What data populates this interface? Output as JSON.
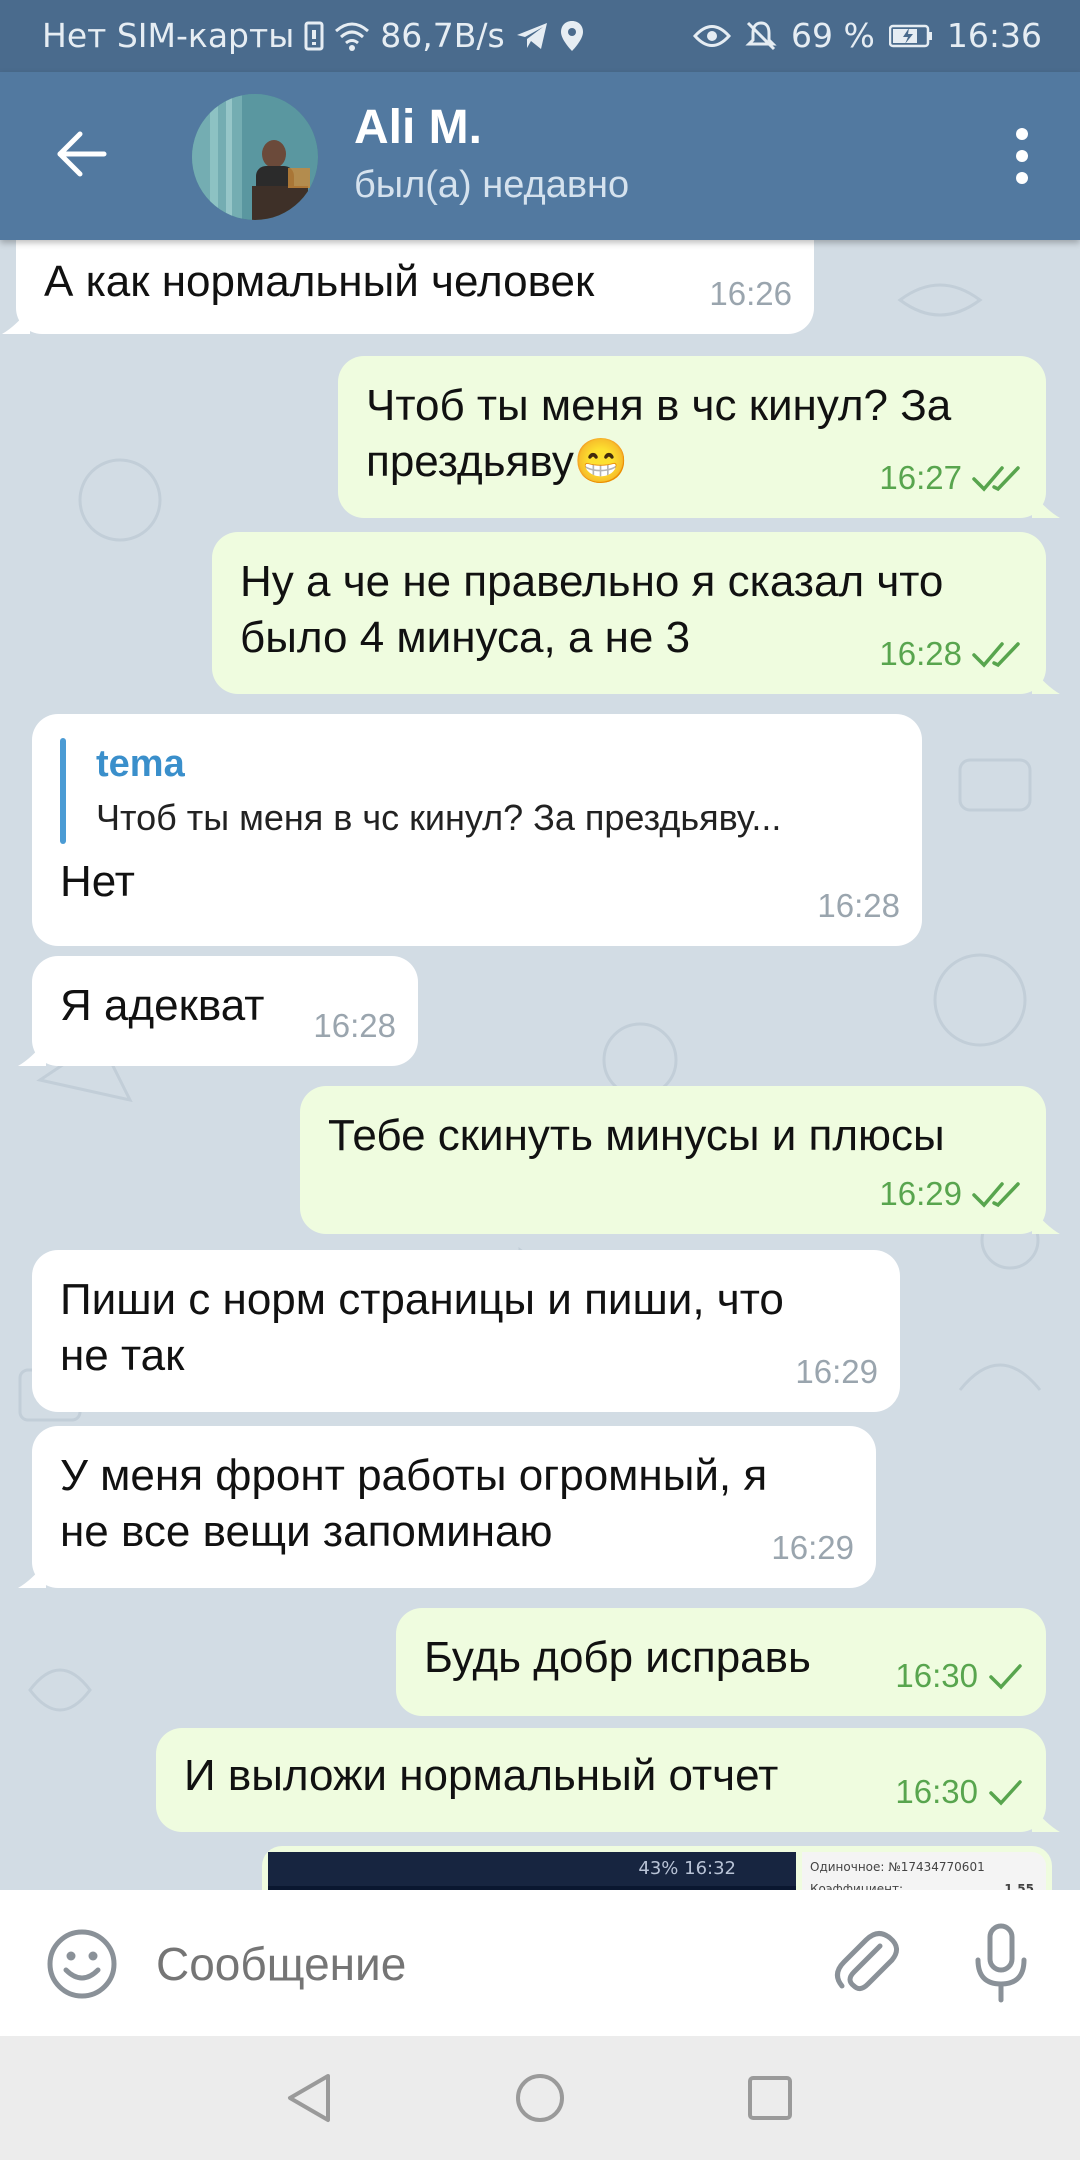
{
  "status_bar": {
    "carrier": "Нет SIM-карты",
    "net_speed": "86,7B/s",
    "battery": "69 %",
    "time": "16:36"
  },
  "header": {
    "contact_name": "Ali M.",
    "contact_status": "был(а) недавно"
  },
  "messages": [
    {
      "dir": "in",
      "text": "А как нормальный человек",
      "time": "16:26"
    },
    {
      "dir": "out",
      "lines": [
        "Чтоб ты меня в чс кинул? За",
        "прездьяву😁"
      ],
      "time": "16:27",
      "status": "read"
    },
    {
      "dir": "out",
      "lines": [
        "Ну а че не правельно я сказал что",
        "было 4 минуса, а не 3"
      ],
      "time": "16:28",
      "status": "read"
    },
    {
      "dir": "in",
      "reply_name": "tema",
      "reply_text": "Чтоб ты меня в чс кинул? За прездьяву...",
      "text": "Нет",
      "time": "16:28"
    },
    {
      "dir": "in",
      "text": "Я адекват",
      "time": "16:28"
    },
    {
      "dir": "out",
      "text": "Тебе скинуть минусы и плюсы",
      "time": "16:29",
      "status": "read"
    },
    {
      "dir": "in",
      "lines": [
        "Пиши с норм страницы и пиши, что",
        "не так"
      ],
      "time": "16:29"
    },
    {
      "dir": "in",
      "lines": [
        "У меня фронт работы огромный, я",
        "не все вещи запоминаю"
      ],
      "time": "16:29"
    },
    {
      "dir": "out",
      "text": "Будь добр исправь",
      "time": "16:30",
      "status": "sent"
    },
    {
      "dir": "out",
      "text": "И выложи нормальный отчет",
      "time": "16:30",
      "status": "sent"
    }
  ],
  "photo_preview": {
    "left_status": "43% 16:32",
    "right_line1": "Одиночное: №17434770601",
    "right_line2": "Коэффициент:",
    "right_value": "1.55"
  },
  "composer": {
    "placeholder": "Сообщение"
  },
  "colors": {
    "header": "#5279a0",
    "status_bar": "#4a6b8d",
    "outgoing_bubble": "#effcdf",
    "incoming_bubble": "#ffffff",
    "check": "#58a54e",
    "reply_accent": "#3a8fcb"
  },
  "icons": [
    "back-arrow-icon",
    "more-vert-icon",
    "emoji-icon",
    "attach-icon",
    "mic-icon",
    "double-check-icon",
    "check-icon"
  ]
}
